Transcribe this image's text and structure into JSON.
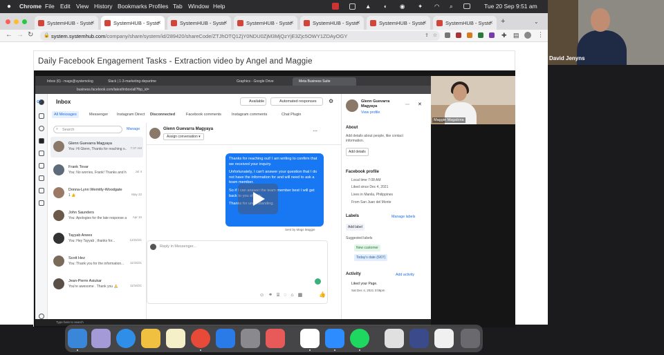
{
  "menubar": {
    "app": "Chrome",
    "menus": [
      "File",
      "Edit",
      "View",
      "History",
      "Bookmarks",
      "Profiles",
      "Tab",
      "Window",
      "Help"
    ],
    "clock": "Tue 20 Sep  9:51 am"
  },
  "browser": {
    "tabs": [
      "SystemHUB - Syste",
      "SystemHUB - Syste",
      "SystemHUB - Syste",
      "SystemHUB - Syste",
      "SystemHUB - Syste",
      "SystemHUB - Syste",
      "SystemHUB - Syste"
    ],
    "address_host": "system.systemhub.com",
    "address_path": "/company/share/system/id/289420/shareCode/ZTJhOTQ1ZjY0NDU0ZjM3MjQzYjE3Zjc5OWY1ZDAyOGY"
  },
  "page": {
    "title": "Daily Facebook Engagement Tasks - Extraction video by Angel and Maggie"
  },
  "video": {
    "inner_tabs": [
      "Inbox (6) - mags@systemolog",
      "Slack | 1-3-marketing-departme",
      "Graphics - Google Drive",
      "Meta Business Suite"
    ],
    "inner_address": "business.facebook.com/latest/inbox/all?fbp_id=",
    "inbox": {
      "title": "Inbox",
      "available": "Available",
      "automated": "Automated responses",
      "subtabs": [
        "All Messages",
        "Messenger",
        "Instagram Direct",
        "Disconnected",
        "Facebook comments",
        "Instagram comments",
        "Chat Plugin"
      ],
      "search_placeholder": "Search",
      "manage": "Manage",
      "conversations": [
        {
          "name": "Glenn Guevarra Magyaya",
          "preview": "You: Hi Glenn, Thanks for reaching o...",
          "time": "7:37 AM"
        },
        {
          "name": "Frank Tovar",
          "preview": "You: No worries, Frank! Thanks and have ...",
          "time": "Jul 4"
        },
        {
          "name": "Donna-Lynn Wemitly-Woodgate",
          "preview": "1 👍",
          "time": "May 22"
        },
        {
          "name": "John Saunders",
          "preview": "You: Apologies for the late response a...",
          "time": "Apr 10"
        },
        {
          "name": "Tayyab Anees",
          "preview": "You: Hey Tayyab , thanks for...",
          "time": "12/22/21"
        },
        {
          "name": "Scott Hez",
          "preview": "You: Thank you for the information...",
          "time": "11/15/21"
        },
        {
          "name": "Jean-Pierre Asiukar",
          "preview": "You're awesome . Thank you 🙏",
          "time": "11/16/21"
        }
      ]
    },
    "chat": {
      "contact": "Glenn Guevarra Magyaya",
      "assign": "Assign conversation",
      "bubble_lines": [
        "Thanks for reaching out! I am writing to confirm that we received your inquiry.",
        "Unfortunately, I can't answer your question that I do not have the information for and will need to ask a team member.",
        "So if I can answer the team member best I will get back to you shortly.",
        "Thanks for understanding."
      ],
      "sent_by": "Sent by Mags Maggie",
      "reply_placeholder": "Reply in Messenger..."
    },
    "details": {
      "name": "Glenn Guevarra Magyaya",
      "view_profile": "View profile",
      "about": "About",
      "about_text": "Add details about people, like contact information.",
      "add_details": "Add details",
      "fb_profile": "Facebook profile",
      "local_time": "Local time 7:08 AM",
      "liked": "Liked since Dec 4, 2021",
      "lives": "Lives in Manila, Philippines",
      "from": "From San Juan del Monte",
      "labels": "Labels",
      "manage_labels": "Manage labels",
      "add_label": "Add label",
      "suggested": "Suggested labels",
      "label1": "New customer",
      "label2": "Today's date (6/07)",
      "activity": "Activity",
      "add_activity": "Add activity",
      "activity_item": "Liked your Page.",
      "activity_date": "Sat Dec 4, 2021 3:08pm"
    },
    "webcam_name": "Maggie Magalona",
    "taskbar_text": "Type here to search"
  },
  "presenter_name": "David Jenyns",
  "colors": {
    "accent": "#1877f2",
    "chrome_bg": "#d9d9dc",
    "menubar": "#2c2c2e"
  }
}
